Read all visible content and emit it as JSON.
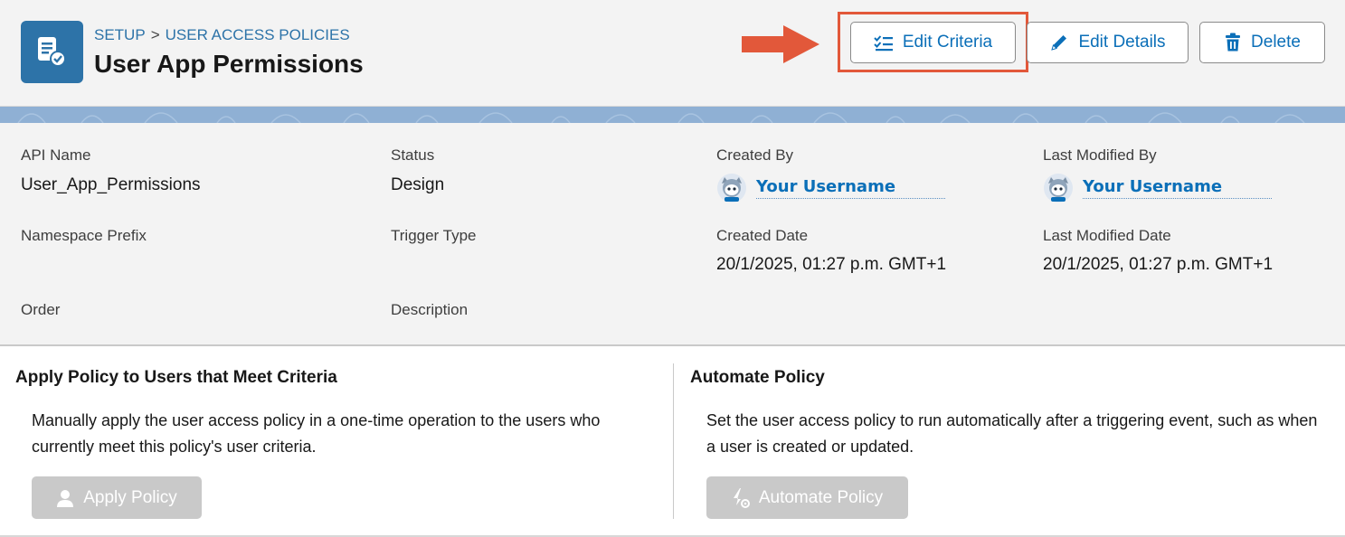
{
  "breadcrumb": {
    "root": "SETUP",
    "separator": ">",
    "current": "USER ACCESS POLICIES"
  },
  "page_title": "User App Permissions",
  "toolbar": {
    "edit_criteria_label": "Edit Criteria",
    "edit_details_label": "Edit Details",
    "delete_label": "Delete"
  },
  "details": {
    "api_name": {
      "label": "API Name",
      "value": "User_App_Permissions"
    },
    "status": {
      "label": "Status",
      "value": "Design"
    },
    "created_by": {
      "label": "Created By",
      "value": "Your Username"
    },
    "last_modified_by": {
      "label": "Last Modified By",
      "value": "Your Username"
    },
    "namespace_prefix": {
      "label": "Namespace Prefix",
      "value": ""
    },
    "trigger_type": {
      "label": "Trigger Type",
      "value": ""
    },
    "created_date": {
      "label": "Created Date",
      "value": "20/1/2025, 01:27 p.m. GMT+1"
    },
    "last_modified_date": {
      "label": "Last Modified Date",
      "value": "20/1/2025, 01:27 p.m. GMT+1"
    },
    "order": {
      "label": "Order",
      "value": ""
    },
    "description": {
      "label": "Description",
      "value": ""
    }
  },
  "apply_section": {
    "title": "Apply Policy to Users that Meet Criteria",
    "text": "Manually apply the user access policy in a one-time operation to the users who currently meet this policy's user criteria.",
    "button_label": "Apply Policy"
  },
  "automate_section": {
    "title": "Automate Policy",
    "text": "Set the user access policy to run automatically after a triggering event, such as when a user is created or updated.",
    "button_label": "Automate Policy"
  },
  "icons": {
    "logo": "policy-document-check-icon",
    "edit_criteria": "checklist-icon",
    "edit_details": "pencil-icon",
    "delete": "trash-icon",
    "apply": "user-icon",
    "automate": "lightning-gear-icon",
    "avatar": "astro-avatar-icon",
    "annotation_arrow": "arrow-right-icon"
  },
  "colors": {
    "brand": "#2d73a8",
    "link": "#0b6fb8",
    "highlight": "#e2583a",
    "disabled": "#c9c9c9"
  }
}
